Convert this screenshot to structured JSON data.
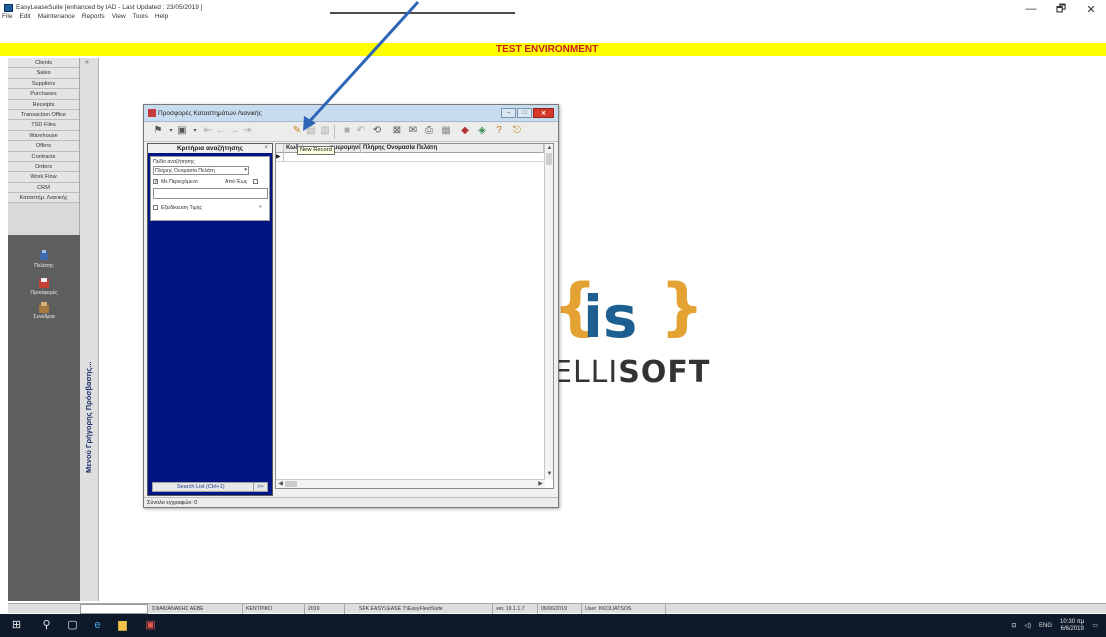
{
  "app": {
    "title": "EasyLeaseSuite [enhanced by IAD - Last Updated : 23/05/2019 ]",
    "menu": [
      "File",
      "Edit",
      "Maintenance",
      "Reports",
      "View",
      "Tools",
      "Help"
    ],
    "window_controls": {
      "minimize": "—",
      "restore": "🗗",
      "close": "✕"
    }
  },
  "environment_banner": "TEST ENVIRONMENT",
  "sidebar": {
    "items": [
      "Clients",
      "Sales",
      "Suppliers",
      "Purchases",
      "Receipts",
      "Transaction Office",
      "TSD Files",
      "Warehouse",
      "Offers",
      "Contracts",
      "Orders",
      "Work Flow",
      "CRM",
      "Καταστήμ. Λιανικής"
    ],
    "shortcuts": [
      {
        "label": "Πελάτης",
        "icon": "client-icon"
      },
      {
        "label": "Προσφορές",
        "icon": "offers-icon"
      },
      {
        "label": "Συνέδρια",
        "icon": "meetings-icon"
      }
    ],
    "collapse_arrow": "»",
    "quick_menu_label": "Μενού Γρήγορης Πρόσβασης..."
  },
  "logo": {
    "brace_open": "{",
    "mark": "is",
    "brace_close": "}",
    "text_light": "ELLI",
    "text_bold": "SOFT"
  },
  "child_window": {
    "title": "Προσφορές Καταστημάτων Λιανικής",
    "controls": {
      "minimize": "–",
      "maximize": "□",
      "close": "✕"
    },
    "tooltip": "New Record",
    "criteria": {
      "title": "Κριτήρια αναζήτησης",
      "close": "×",
      "field_label": "Πεδίο αναζήτησης",
      "field_value": "Πλήρης Ονομασία Πελάτη",
      "contains_label": "Με Περιεχόμενο",
      "contains_checked": "✓",
      "from_to_label": "Από-Έως",
      "extended_price_label": "Εξειδίκευση Τιμής",
      "extended_arrow": "»",
      "search_button": "Search List (Ctrl+1)",
      "search_more": ">>"
    },
    "grid": {
      "columns": [
        "Κωδ",
        "ημερομηνία",
        "Πλήρης Ονομασία Πελάτη"
      ],
      "row_indicator": "▶"
    },
    "status": "Σύνολο εγγραφών: 0"
  },
  "status_bar": {
    "company": "ΣΦΑΚΙΑΝΑΚΗΣ ΑΕΒΕ",
    "branch": "ΚΕΝΤΡΙΚΟ",
    "year": "2019",
    "app_info": "SFK EASYLEASE T:\\EasyFleetSuite",
    "version": "ver. 19.1.1.7",
    "date": "06/06/2019",
    "user": "User: KKOLIATSOS"
  },
  "taskbar": {
    "tray_lang": "ENG",
    "time": "10:30 πμ",
    "date": "6/6/2019"
  },
  "colors": {
    "banner_bg": "#ffff00",
    "banner_text": "#cc1d1d",
    "criteria_bg": "#001482",
    "logo_orange": "#e4a232",
    "logo_blue": "#1d5f91",
    "annotation_arrow": "#2f66b8"
  }
}
